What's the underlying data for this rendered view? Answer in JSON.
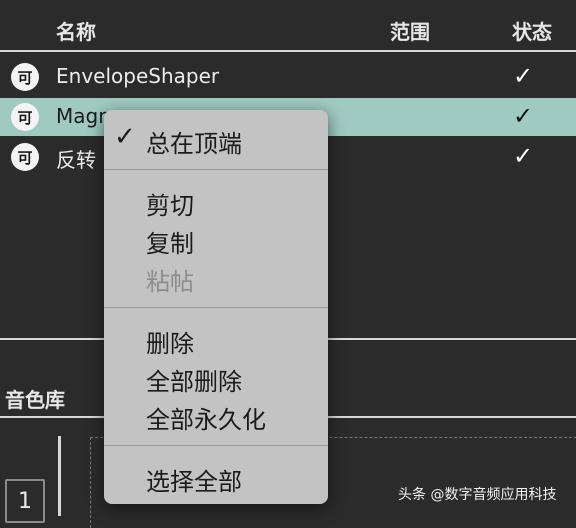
{
  "table": {
    "headers": {
      "name": "名称",
      "range": "范围",
      "status": "状态"
    },
    "rows": [
      {
        "icon_glyph": "可",
        "name": "EnvelopeShaper",
        "status": "✓"
      },
      {
        "icon_glyph": "可",
        "name": "Magn",
        "status": "✓"
      },
      {
        "icon_glyph": "可",
        "name": "反转",
        "status": "✓"
      }
    ]
  },
  "sections": {
    "library_title": "音色库"
  },
  "slot": {
    "number": "1"
  },
  "context_menu": {
    "always_on_top": {
      "mark": "✓",
      "label": "总在顶端"
    },
    "cut": "剪切",
    "copy": "复制",
    "paste": "粘帖",
    "delete": "删除",
    "delete_all": "全部删除",
    "make_all_permanent": "全部永久化",
    "select_all": "选择全部"
  },
  "watermark": "头条 @数字音频应用科技",
  "colors": {
    "background": "#2b2b2b",
    "selected_row": "#9fcac2",
    "menu_bg": "#c3c3c3"
  },
  "icons": {
    "row_icon": "plugin-icon",
    "status": "checkmark-icon"
  }
}
